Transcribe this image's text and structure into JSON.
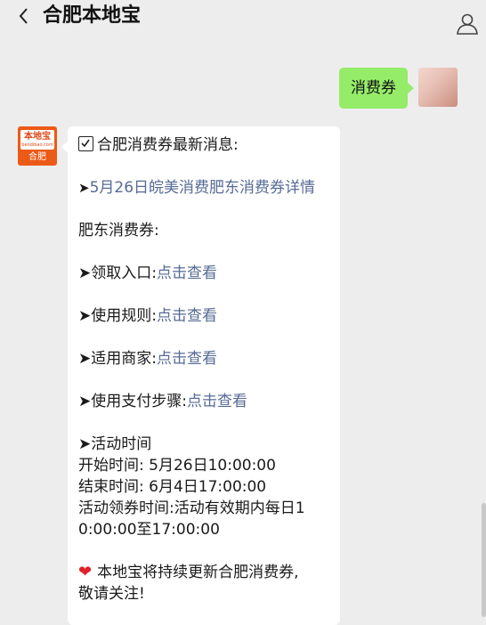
{
  "header": {
    "title": "合肥本地宝"
  },
  "outgoing": {
    "text": "消费券"
  },
  "bot": {
    "logo_text": "本地宝",
    "logo_sub": "bendibao.com",
    "logo_city": "合肥"
  },
  "message": {
    "heading": "合肥消费券最新消息:",
    "link_news": "5月26日皖美消费肥东消费券详情",
    "section_title": "肥东消费券:",
    "items": [
      {
        "label": "➤领取入口:",
        "link": "点击查看"
      },
      {
        "label": "➤使用规则:",
        "link": "点击查看"
      },
      {
        "label": "➤适用商家:",
        "link": "点击查看"
      },
      {
        "label": "➤使用支付步骤:",
        "link": "点击查看"
      }
    ],
    "activity_title": "➤活动时间",
    "start_time": "开始时间: 5月26日10:00:00",
    "end_time": "结束时间: 6月4日17:00:00",
    "claim_time_1": "活动领券时间:活动有效期内每日1",
    "claim_time_2": "0:00:00至17:00:00",
    "footer_1": "本地宝将持续更新合肥消费券,",
    "footer_2": "敬请关注!"
  },
  "colors": {
    "link": "#576b95",
    "outgoing_bubble": "#95ec69",
    "bot_avatar": "#ec5a17"
  }
}
